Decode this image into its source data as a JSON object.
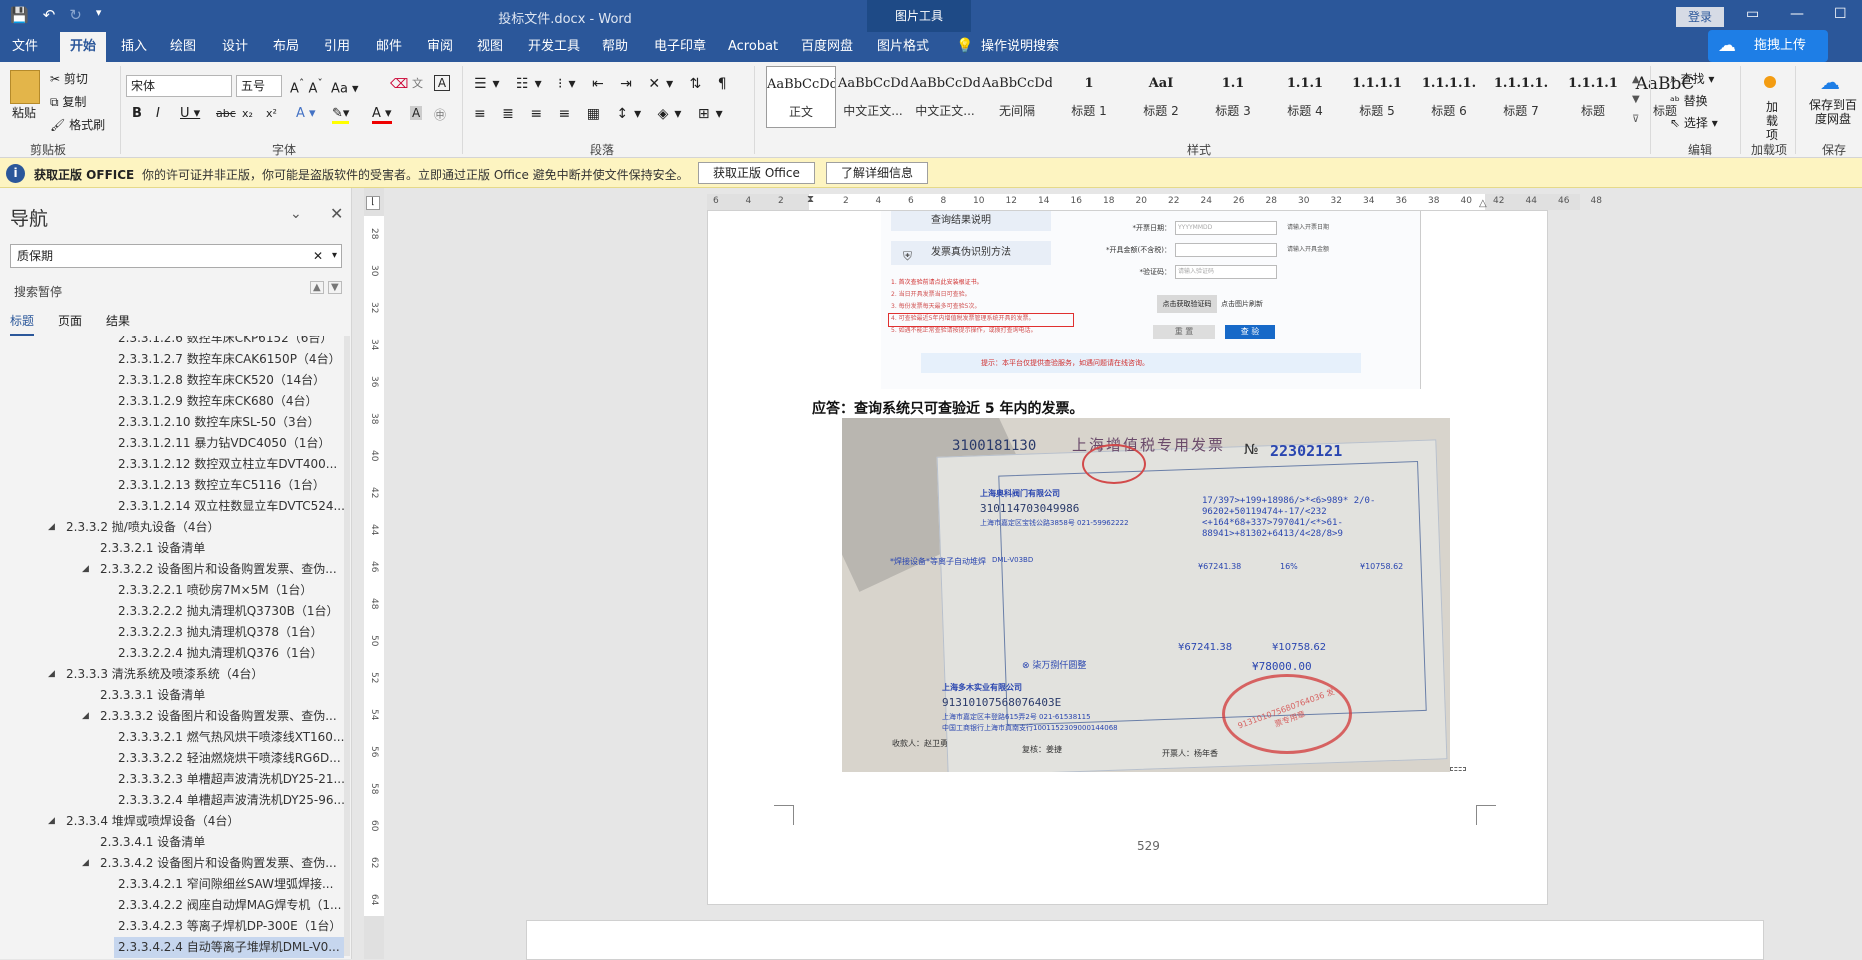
{
  "window": {
    "doc_title": "投标文件.docx - Word",
    "picture_tools": "图片工具",
    "login": "登录"
  },
  "tabs": [
    "文件",
    "开始",
    "插入",
    "绘图",
    "设计",
    "布局",
    "引用",
    "邮件",
    "审阅",
    "视图",
    "开发工具",
    "帮助",
    "电子印章",
    "Acrobat",
    "百度网盘",
    "图片格式",
    "操作说明搜索"
  ],
  "upload_label": "拖拽上传",
  "ribbon": {
    "clipboard": {
      "paste": "粘贴",
      "cut": "剪切",
      "copy": "复制",
      "format_painter": "格式刷",
      "label": "剪贴板"
    },
    "font": {
      "name": "宋体",
      "size": "五号",
      "label": "字体"
    },
    "paragraph": {
      "label": "段落"
    },
    "styles": {
      "label": "样式",
      "items": [
        {
          "preview": "AaBbCcDdE",
          "name": "正文"
        },
        {
          "preview": "AaBbCcDd",
          "name": "中文正文..."
        },
        {
          "preview": "AaBbCcDd",
          "name": "中文正文..."
        },
        {
          "preview": "AaBbCcDdI",
          "name": "无间隔"
        },
        {
          "preview": "1",
          "name": "标题 1"
        },
        {
          "preview": "AaI",
          "name": "标题 2"
        },
        {
          "preview": "1.1",
          "name": "标题 3"
        },
        {
          "preview": "1.1.1",
          "name": "标题 4"
        },
        {
          "preview": "1.1.1.1",
          "name": "标题 5"
        },
        {
          "preview": "1.1.1.1.",
          "name": "标题 6"
        },
        {
          "preview": "1.1.1.1.",
          "name": "标题 7"
        },
        {
          "preview": "1.1.1.1",
          "name": "标题"
        },
        {
          "preview": "AaBbC",
          "name": "标题"
        }
      ]
    },
    "editing": {
      "find": "查找",
      "replace": "替换",
      "select": "选择",
      "label": "编辑"
    },
    "addins": {
      "label": "加载项",
      "item": "加载项"
    },
    "save": {
      "item": "保存到百度网盘",
      "label": "保存"
    }
  },
  "infobar": {
    "title": "获取正版 OFFICE",
    "message": "你的许可证并非正版，你可能是盗版软件的受害者。立即通过正版 Office 避免中断并使文件保持安全。",
    "btn1": "获取正版 Office",
    "btn2": "了解详细信息"
  },
  "nav": {
    "title": "导航",
    "search_value": "质保期",
    "paused": "搜索暂停",
    "tabs": [
      "标题",
      "页面",
      "结果"
    ],
    "items": [
      {
        "text": "2.3.3.1.2.6 数控车床CKP6152（6台）",
        "level": 3
      },
      {
        "text": "2.3.3.1.2.7 数控车床CAK6150P（4台）",
        "level": 3
      },
      {
        "text": "2.3.3.1.2.8 数控车床CK520（14台）",
        "level": 3
      },
      {
        "text": "2.3.3.1.2.9 数控车床CK680（4台）",
        "level": 3
      },
      {
        "text": "2.3.3.1.2.10 数控车床SL-50（3台）",
        "level": 3
      },
      {
        "text": "2.3.3.1.2.11 暴力钻VDC4050（1台）",
        "level": 3
      },
      {
        "text": "2.3.3.1.2.12 数控双立柱立车DVT400...",
        "level": 3
      },
      {
        "text": "2.3.3.1.2.13 数控立车C5116（1台）",
        "level": 3
      },
      {
        "text": "2.3.3.1.2.14 双立柱数显立车DVTC524...",
        "level": 3
      },
      {
        "text": "2.3.3.2 抛/喷丸设备（4台）",
        "level": 1,
        "caret": true
      },
      {
        "text": "2.3.3.2.1 设备清单",
        "level": 2
      },
      {
        "text": "2.3.3.2.2 设备图片和设备购置发票、查伪...",
        "level": 2,
        "caret": true
      },
      {
        "text": "2.3.3.2.2.1 喷砂房7M×5M（1台）",
        "level": 3
      },
      {
        "text": "2.3.3.2.2.2 抛丸清理机Q3730B（1台）",
        "level": 3
      },
      {
        "text": "2.3.3.2.2.3 抛丸清理机Q378（1台）",
        "level": 3
      },
      {
        "text": "2.3.3.2.2.4 抛丸清理机Q376（1台）",
        "level": 3
      },
      {
        "text": "2.3.3.3 清洗系统及喷漆系统（4台）",
        "level": 1,
        "caret": true
      },
      {
        "text": "2.3.3.3.1 设备清单",
        "level": 2
      },
      {
        "text": "2.3.3.3.2 设备图片和设备购置发票、查伪...",
        "level": 2,
        "caret": true
      },
      {
        "text": "2.3.3.3.2.1 燃气热风烘干喷漆线XT160...",
        "level": 3
      },
      {
        "text": "2.3.3.3.2.2 轻油燃烧烘干喷漆线RG6D...",
        "level": 3
      },
      {
        "text": "2.3.3.3.2.3 单槽超声波清洗机DY25-21...",
        "level": 3
      },
      {
        "text": "2.3.3.3.2.4 单槽超声波清洗机DY25-96...",
        "level": 3
      },
      {
        "text": "2.3.3.4 堆焊或喷焊设备（4台）",
        "level": 1,
        "caret": true
      },
      {
        "text": "2.3.3.4.1 设备清单",
        "level": 2
      },
      {
        "text": "2.3.3.4.2 设备图片和设备购置发票、查伪...",
        "level": 2,
        "caret": true
      },
      {
        "text": "2.3.3.4.2.1 窄间隙细丝SAW埋弧焊接...",
        "level": 3
      },
      {
        "text": "2.3.3.4.2.2 阀座自动焊MAG焊专机（1...",
        "level": 3
      },
      {
        "text": "2.3.3.4.2.3 等离子焊机DP-300E（1台）",
        "level": 3
      },
      {
        "text": "2.3.3.4.2.4 自动等离子堆焊机DML-V0...",
        "level": 3,
        "selected": true
      }
    ]
  },
  "hruler_labels": [
    "6",
    "4",
    "2",
    "",
    "2",
    "4",
    "6",
    "8",
    "10",
    "12",
    "14",
    "16",
    "18",
    "20",
    "22",
    "24",
    "26",
    "28",
    "30",
    "32",
    "34",
    "36",
    "38",
    "40",
    "42",
    "44",
    "46",
    "48"
  ],
  "vruler_labels": [
    "28",
    "30",
    "32",
    "34",
    "36",
    "38",
    "40",
    "42",
    "44",
    "46",
    "48",
    "50",
    "52",
    "54",
    "56",
    "58",
    "60",
    "62",
    "64"
  ],
  "document": {
    "screenshot": {
      "menu1": "查询结果说明",
      "menu2": "发票真伪识别方法",
      "notes": [
        "1. 首次查验前请点此安装根证书。",
        "2. 当日开具发票当日可查验。",
        "3. 每份发票每天最多可查验5次。",
        "4. 可查验最近5年内增值税发票管理系统开具的发票。",
        "5. 如遇不能正常查验请按提示操作，或拨打查询电话。"
      ],
      "fields": [
        {
          "label": "*开票日期：",
          "ph": "YYYYMMDD",
          "hint": "请输入开票日期"
        },
        {
          "label": "*开具金额(不含税)：",
          "ph": "",
          "hint": "请输入开具金额"
        },
        {
          "label": "*验证码：",
          "ph": "请输入验证码",
          "hint": ""
        }
      ],
      "captcha_btn": "点击获取验证码",
      "captcha_hint": "点击图片刷新",
      "reset": "重 置",
      "submit": "查 验",
      "banner": "提示：本平台仅提供查验服务，如遇问题请在线咨询。"
    },
    "answer": "应答：查询系统只可查验近 5 年内的发票。",
    "invoice": {
      "code": "3100181130",
      "title": "上海增值税专用发票",
      "no_label": "№",
      "number": "22302121",
      "buyer": "上海奥科阀门有限公司",
      "buyer_tax": "310114703049986",
      "buyer_addr": "上海市嘉定区宝钱公路3858号 021-59962222",
      "item": "*焊接设备*等离子自动堆焊",
      "model": "DML-V03BD",
      "amount": "¥67241.38",
      "rate": "16%",
      "tax": "¥10758.62",
      "total_words": "⊗ 柒万捌仟圆整",
      "total": "¥78000.00",
      "seller": "上海多木实业有限公司",
      "seller_tax": "91310107568076403E",
      "seller_addr": "上海市嘉定区丰登路615弄2号 021-61538115",
      "seller_bank": "中国工商银行上海市真南支行1001152309000144068",
      "payee": "收款人：赵卫勇",
      "checker": "复核：姜捷",
      "drawer": "开票人：杨年香",
      "stamp": "913101075680764036 发票专用章"
    },
    "page_number": "529"
  }
}
